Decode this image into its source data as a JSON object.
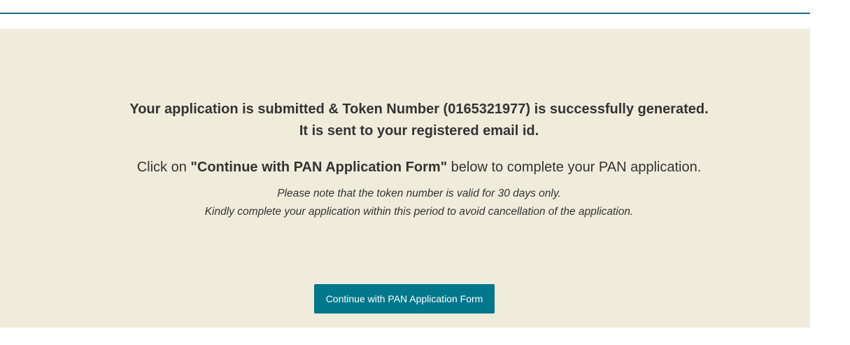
{
  "confirmation": {
    "line1": "Your application is submitted & Token Number (0165321977) is successfully generated.",
    "line2": "It is sent to your registered email id."
  },
  "instruction": {
    "prefix": "Click on ",
    "emphasis": "\"Continue with PAN Application Form\"",
    "suffix": " below to complete your PAN application."
  },
  "notes": {
    "validity": "Please note that the token number is valid for 30 days only.",
    "deadline": "Kindly complete your application within this period to avoid cancellation of the application."
  },
  "actions": {
    "continue_label": "Continue with PAN Application Form"
  },
  "colors": {
    "panel_background": "#efecdc",
    "accent": "#00778b",
    "rule": "#1a6e8a"
  }
}
